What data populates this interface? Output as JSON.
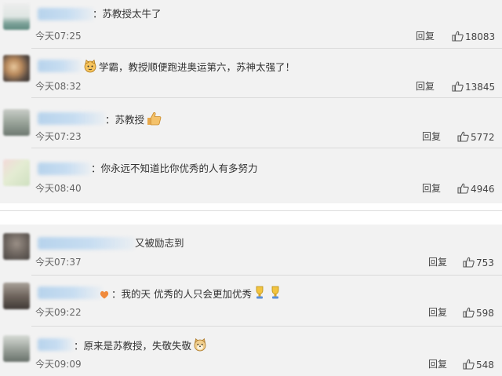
{
  "comments_top": [
    {
      "text": "：苏教授太牛了",
      "time": "今天07:25",
      "reply": "回复",
      "likes": "18083"
    },
    {
      "text": "学霸，教授顺便跑进奥运第六，苏神太强了！",
      "time": "今天08:32",
      "reply": "回复",
      "likes": "13845"
    },
    {
      "text": "：苏教授",
      "time": "今天07:23",
      "reply": "回复",
      "likes": "5772"
    },
    {
      "text": "：你永远不知道比你优秀的人有多努力",
      "time": "今天08:40",
      "reply": "回复",
      "likes": "4946"
    }
  ],
  "comments_bottom": [
    {
      "text": "又被励志到",
      "time": "今天07:37",
      "reply": "回复",
      "likes": "753"
    },
    {
      "text": "：我的天 优秀的人只会更加优秀",
      "time": "今天09:22",
      "reply": "回复",
      "likes": "598"
    },
    {
      "text": "：原来是苏教授，失敬失敬",
      "time": "今天09:09",
      "reply": "回复",
      "likes": "548"
    }
  ],
  "icons": {
    "like": "thumbs-up-icon",
    "cat": "cat-face-emoji-icon",
    "thumb_emoji": "thumbs-up-emoji-icon",
    "doge": "doge-emoji-icon",
    "trophy": "trophy-emoji-icon"
  },
  "colors": {
    "background": "#f2f2f2",
    "text": "#333333",
    "time": "#666666",
    "name_blur": "#b7d3ec"
  }
}
